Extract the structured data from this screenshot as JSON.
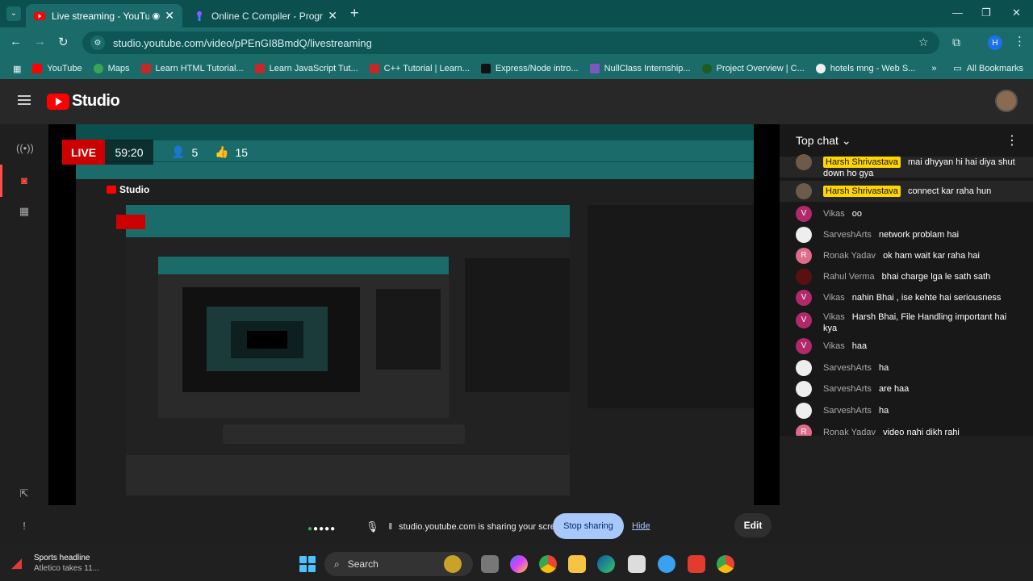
{
  "browser": {
    "tabs": [
      {
        "title": "Live streaming - YouTube Studio",
        "active": true
      },
      {
        "title": "Online C Compiler - Programiz",
        "active": false
      }
    ],
    "url": "studio.youtube.com/video/pPEnGI8BmdQ/livestreaming",
    "profile_initial": "H",
    "bookmarks": [
      "YouTube",
      "Maps",
      "Learn HTML Tutorial...",
      "Learn JavaScript Tut...",
      "C++ Tutorial | Learn...",
      "Express/Node intro...",
      "NullClass Internship...",
      "Project Overview | C...",
      "hotels mng - Web S..."
    ],
    "all_bookmarks_label": "All Bookmarks",
    "more_bookmarks": "»"
  },
  "studio": {
    "logo_text": "Studio"
  },
  "stream": {
    "live_label": "LIVE",
    "elapsed": "59:20",
    "viewers": "5",
    "likes": "15"
  },
  "chat": {
    "title": "Top chat",
    "messages": [
      {
        "name": "Harsh Shrivastava",
        "text": "mai dhyyan hi hai diya shut down ho gya",
        "owner": true,
        "avatar": "photo"
      },
      {
        "name": "Harsh Shrivastava",
        "text": "connect kar raha hun",
        "owner": true,
        "avatar": "photo"
      },
      {
        "name": "Vikas",
        "text": "oo",
        "owner": false,
        "avatar": "V"
      },
      {
        "name": "SarveshArts",
        "text": "network problam hai",
        "owner": false,
        "avatar": "logo"
      },
      {
        "name": "Ronak Yadav",
        "text": "ok ham wait kar raha hai",
        "owner": false,
        "avatar": "R"
      },
      {
        "name": "Rahul Verma",
        "text": "bhai charge lga le sath sath",
        "owner": false,
        "avatar": "photo"
      },
      {
        "name": "Vikas",
        "text": "nahin Bhai , ise kehte hai seriousness",
        "owner": false,
        "avatar": "V"
      },
      {
        "name": "Vikas",
        "text": "Harsh Bhai, File Handling important hai kya",
        "owner": false,
        "avatar": "V"
      },
      {
        "name": "Vikas",
        "text": "haa",
        "owner": false,
        "avatar": "V"
      },
      {
        "name": "SarveshArts",
        "text": "ha",
        "owner": false,
        "avatar": "logo"
      },
      {
        "name": "SarveshArts",
        "text": "are haa",
        "owner": false,
        "avatar": "logo"
      },
      {
        "name": "SarveshArts",
        "text": "ha",
        "owner": false,
        "avatar": "logo"
      },
      {
        "name": "Ronak Yadav",
        "text": "video nahi dikh rahi",
        "owner": false,
        "avatar": "R"
      }
    ]
  },
  "screenshare": {
    "message": "studio.youtube.com is sharing your screen.",
    "stop_label": "Stop sharing",
    "hide_label": "Hide",
    "edit_label": "Edit"
  },
  "taskbar": {
    "news_title": "Sports headline",
    "news_sub": "Atletico takes 11...",
    "search_label": "Search"
  },
  "colors": {
    "tab_bg": "#0b4f4f",
    "toolbar_bg": "#1b6b6b",
    "live_red": "#cc0000",
    "owner_badge": "#ffd600",
    "stop_btn": "#a8c7fa"
  }
}
